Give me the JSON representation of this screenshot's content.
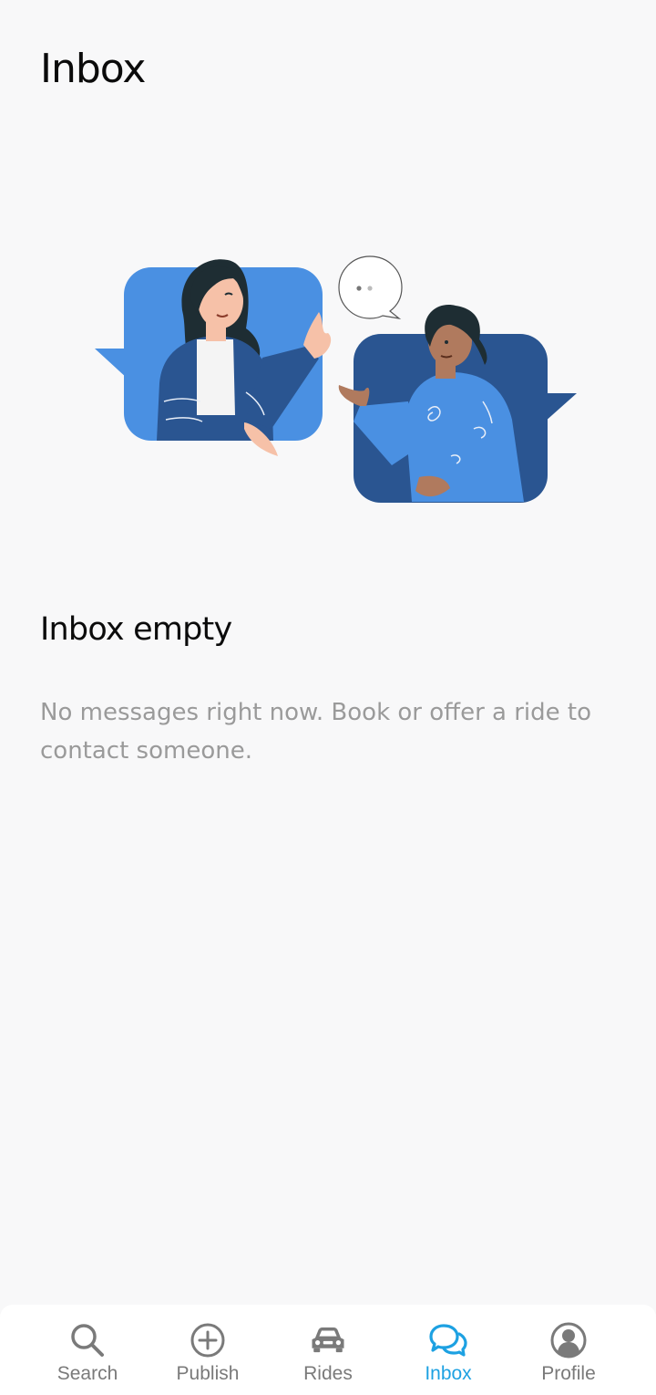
{
  "header": {
    "title": "Inbox"
  },
  "empty_state": {
    "title": "Inbox empty",
    "message": "No messages right now. Book or offer a ride to contact someone."
  },
  "bottom_nav": {
    "items": [
      {
        "label": "Search",
        "icon": "search-icon",
        "active": false
      },
      {
        "label": "Publish",
        "icon": "plus-circle-icon",
        "active": false
      },
      {
        "label": "Rides",
        "icon": "car-icon",
        "active": false
      },
      {
        "label": "Inbox",
        "icon": "chat-bubbles-icon",
        "active": true
      },
      {
        "label": "Profile",
        "icon": "user-icon",
        "active": false
      }
    ],
    "active_color": "#1da1e2",
    "inactive_color": "#7a7a7a"
  },
  "colors": {
    "background": "#f8f8f9",
    "bubble_light": "#4a90e2",
    "bubble_dark": "#2a5591"
  }
}
